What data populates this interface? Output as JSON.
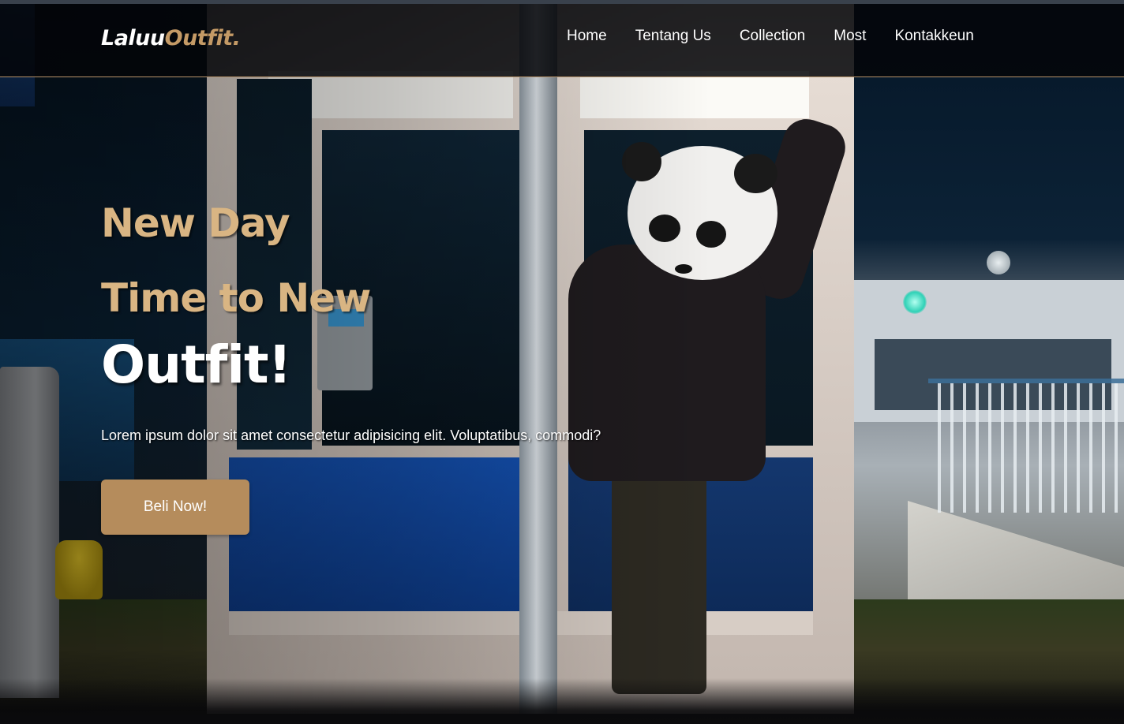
{
  "brand": {
    "name_primary": "Laluu",
    "name_accent": "Outfit.",
    "accent_color": "#c49a66"
  },
  "nav": {
    "items": [
      {
        "label": "Home"
      },
      {
        "label": "Tentang Us"
      },
      {
        "label": "Collection"
      },
      {
        "label": "Most"
      },
      {
        "label": "Kontakkeun"
      }
    ]
  },
  "hero": {
    "line1": "New Day",
    "line2": "Time to New",
    "line3": "Outfit!",
    "lead": "Lorem ipsum dolor sit amet consectetur adipisicing elit. Voluptatibus, commodi?",
    "cta_label": "Beli Now!",
    "headline_color": "#d9b583",
    "button_color": "#b58c5c"
  }
}
